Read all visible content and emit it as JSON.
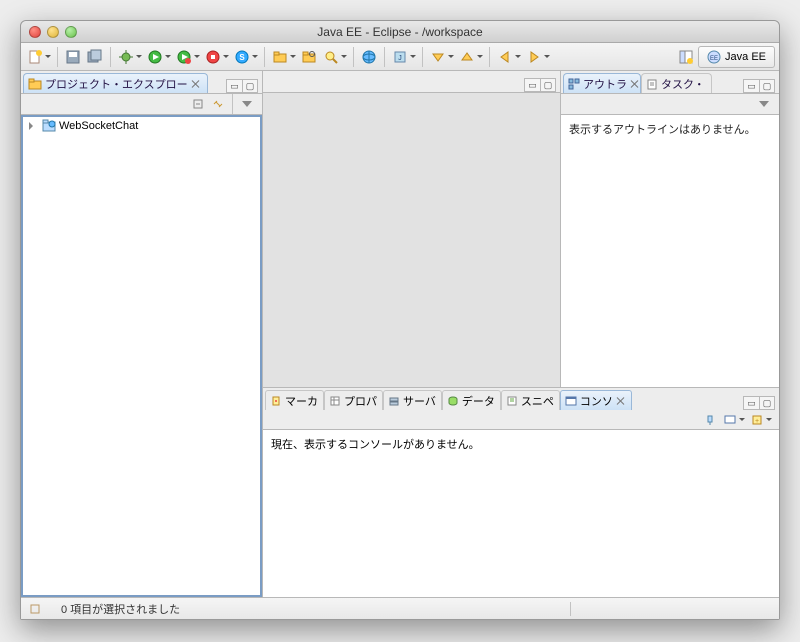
{
  "title": "Java EE - Eclipse - /workspace",
  "perspective": {
    "label": "Java EE"
  },
  "project_explorer": {
    "tab_label": "プロジェクト・エクスプロー",
    "items": [
      {
        "name": "WebSocketChat"
      }
    ]
  },
  "outline": {
    "tab_label": "アウトラ",
    "message": "表示するアウトラインはありません。"
  },
  "tasks": {
    "tab_label": "タスク・"
  },
  "bottom": {
    "tabs": {
      "marker": "マーカ",
      "properties": "プロパ",
      "server": "サーバ",
      "data": "データ",
      "snippets": "スニペ",
      "console": "コンソ"
    },
    "console_msg": "現在、表示するコンソールがありません。"
  },
  "status": {
    "selection": "0 項目が選択されました"
  }
}
